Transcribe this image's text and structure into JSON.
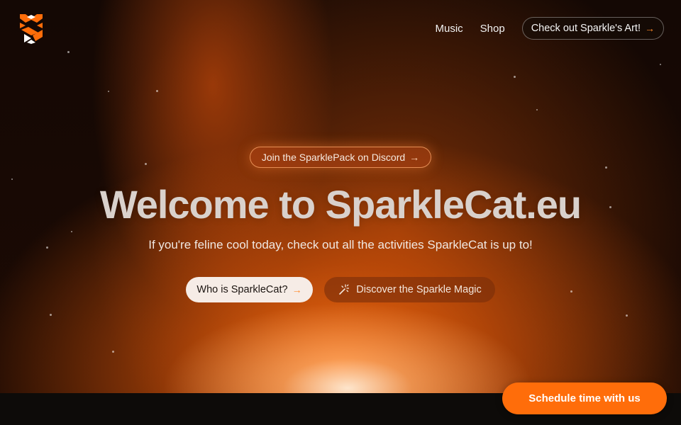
{
  "nav": {
    "links": [
      "Music",
      "Shop"
    ],
    "cta_label": "Check out Sparkle's Art!",
    "cta_arrow": "→"
  },
  "hero": {
    "discord_label": "Join the SparklePack on Discord",
    "discord_arrow": "→",
    "headline": "Welcome to SparkleCat.eu",
    "subheadline": "If you're feline cool today, check out all the activities SparkleCat is up to!",
    "primary_button": "Who is SparkleCat?",
    "primary_arrow": "→",
    "secondary_button": "Discover the Sparkle Magic"
  },
  "floating": {
    "schedule_label": "Schedule time with us"
  },
  "colors": {
    "accent": "#ff6d0a",
    "background": "#0c0a08",
    "headline": "#d9d1cc"
  },
  "icons": {
    "logo": "sparklecat-logo",
    "secondary_button": "magic-wand-icon"
  }
}
